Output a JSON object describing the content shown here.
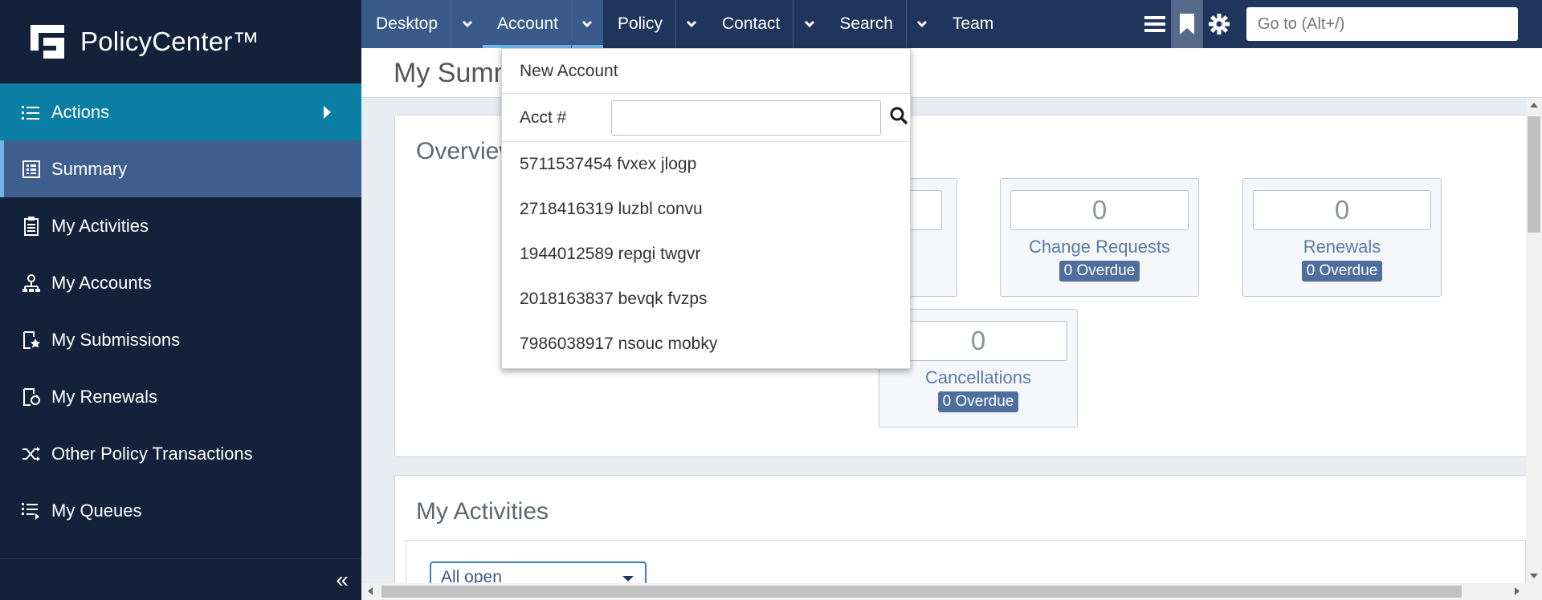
{
  "app": {
    "name": "PolicyCenter™"
  },
  "sidebar": {
    "items": [
      {
        "label": "Actions"
      },
      {
        "label": "Summary"
      },
      {
        "label": "My Activities"
      },
      {
        "label": "My Accounts"
      },
      {
        "label": "My Submissions"
      },
      {
        "label": "My Renewals"
      },
      {
        "label": "Other Policy Transactions"
      },
      {
        "label": "My Queues"
      }
    ],
    "collapse_icon": "«"
  },
  "nav": {
    "tabs": [
      {
        "label": "Desktop"
      },
      {
        "label": "Account"
      },
      {
        "label": "Policy"
      },
      {
        "label": "Contact"
      },
      {
        "label": "Search"
      },
      {
        "label": "Team"
      }
    ],
    "goto_placeholder": "Go to (Alt+/)"
  },
  "page": {
    "title": "My Summary"
  },
  "overview": {
    "title": "Overview",
    "tiles": [
      {
        "label": "Change Requests",
        "value": "0",
        "overdue": "0 Overdue"
      },
      {
        "label": "Renewals",
        "value": "0",
        "overdue": "0 Overdue"
      },
      {
        "label": "Cancellations",
        "value": "0",
        "overdue": "0 Overdue"
      }
    ]
  },
  "activities": {
    "title": "My Activities",
    "filter": "All open"
  },
  "account_menu": {
    "new_account": "New Account",
    "acct_label": "Acct #",
    "recent": [
      "5711537454 fvxex jlogp",
      "2718416319 luzbl convu",
      "1944012589 repgi twgvr",
      "2018163837 bevqk fvzps",
      "7986038917 nsouc mobky"
    ]
  },
  "colors": {
    "sidebar": "#13223a",
    "topbar": "#1f355b",
    "accent": "#0a7ea4",
    "badge": "#4e6e9e"
  }
}
